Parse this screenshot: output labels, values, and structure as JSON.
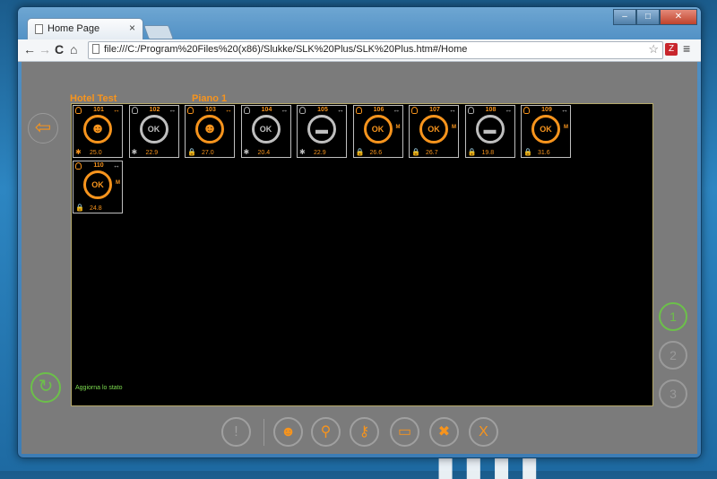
{
  "browser": {
    "tab_title": "Home Page",
    "tab_close": "×",
    "window_buttons": [
      "–",
      "□",
      "✕"
    ],
    "nav": {
      "back": "←",
      "forward": "→",
      "reload": "C",
      "home": "⌂"
    },
    "url": "file:///C:/Program%20Files%20(x86)/Slukke/SLK%20Plus/SLK%20Plus.htm#/Home",
    "bookmark_star": "☆",
    "extension": "Z",
    "menu": "≡"
  },
  "app": {
    "hotel_name": "Hotel Test",
    "floor_name": "Piano 1",
    "refresh_label": "Aggiorna lo stato",
    "pages": [
      "1",
      "2",
      "3"
    ],
    "back_icon": "⇦"
  },
  "rooms": [
    {
      "number": "101",
      "temp": "25.0",
      "state": "occupied-person",
      "status": "fan",
      "lit": true
    },
    {
      "number": "102",
      "temp": "22.9",
      "state": "ok-grey",
      "status": "fan",
      "lit": false
    },
    {
      "number": "103",
      "temp": "27.0",
      "state": "occupied-person",
      "status": "lock",
      "lit": true
    },
    {
      "number": "104",
      "temp": "20.4",
      "state": "ok-grey",
      "status": "fan",
      "lit": false
    },
    {
      "number": "105",
      "temp": "22.9",
      "state": "bed-grey",
      "status": "fan",
      "lit": false
    },
    {
      "number": "106",
      "temp": "26.6",
      "state": "ok-orange",
      "status": "lock",
      "lit": true
    },
    {
      "number": "107",
      "temp": "26.7",
      "state": "ok-orange",
      "status": "lock",
      "lit": true
    },
    {
      "number": "108",
      "temp": "19.8",
      "state": "bed-grey",
      "status": "lock",
      "lit": false
    },
    {
      "number": "109",
      "temp": "31.6",
      "state": "ok-orange",
      "status": "lock",
      "lit": true
    },
    {
      "number": "110",
      "temp": "24.8",
      "state": "ok-orange",
      "status": "lock",
      "lit": true
    }
  ],
  "bottom_toolbar": [
    {
      "name": "alert-button",
      "glyph": "!",
      "enabled": false
    },
    {
      "name": "guest-button",
      "glyph": "☻",
      "enabled": true
    },
    {
      "name": "search-button",
      "glyph": "⚲",
      "enabled": true
    },
    {
      "name": "key-button",
      "glyph": "⚷",
      "enabled": true
    },
    {
      "name": "bed-button",
      "glyph": "▭",
      "enabled": true
    },
    {
      "name": "tools-button",
      "glyph": "✖",
      "enabled": true
    },
    {
      "name": "cancel-button",
      "glyph": "X",
      "enabled": true
    }
  ],
  "colors": {
    "accent": "#f7941d",
    "green": "#6cc04a",
    "panel": "#000000",
    "background": "#7b7b7b"
  }
}
